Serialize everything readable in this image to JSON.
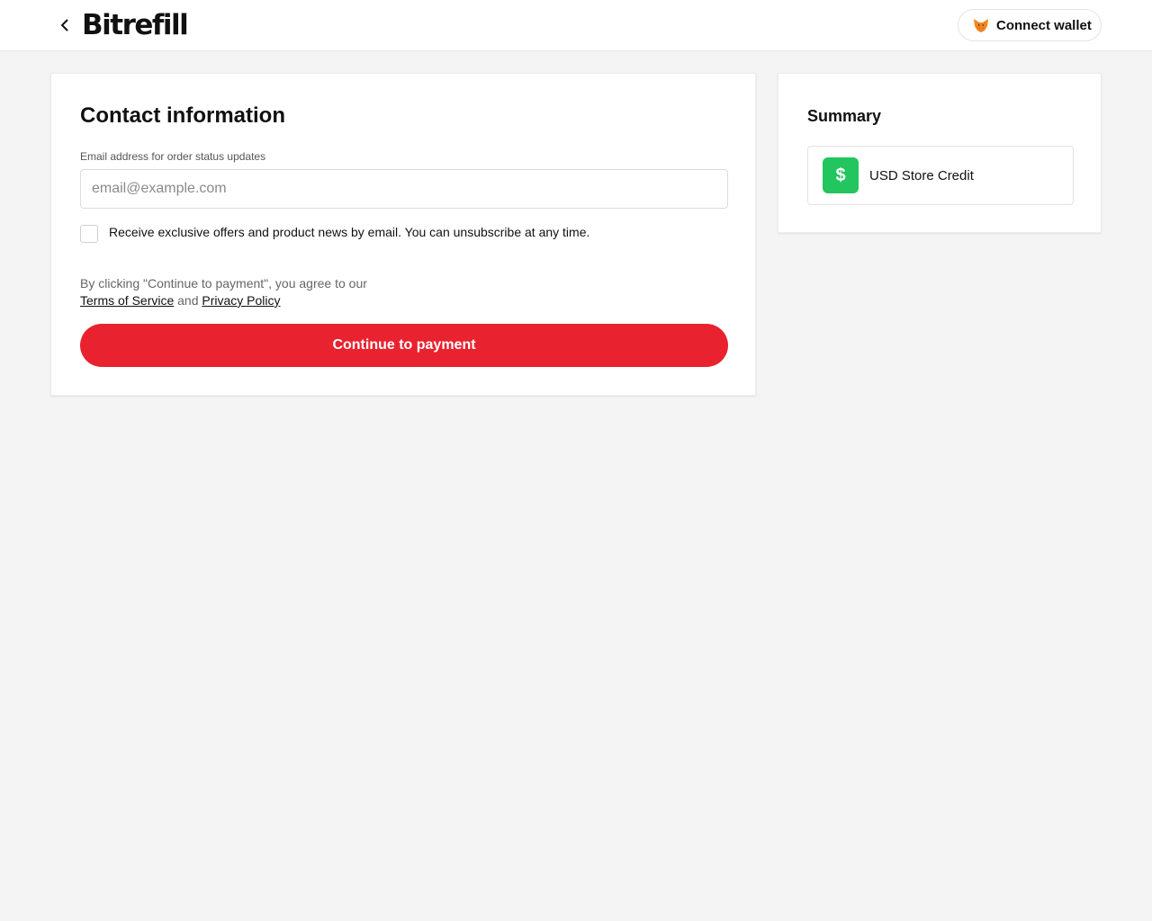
{
  "header": {
    "back_icon": "chevron-left-icon",
    "logo_text": "Bitrefill",
    "connect_wallet_label": "Connect wallet",
    "wallet_icon": "fox-icon"
  },
  "contact": {
    "title": "Contact information",
    "email_label": "Email address for order status updates",
    "email_placeholder": "email@example.com",
    "email_value": "",
    "offers_checked": false,
    "offers_label": "Receive exclusive offers and product news by email. You can unsubscribe at any time.",
    "agree_prefix": "By clicking \"Continue to payment\", you agree to our ",
    "terms_link": "Terms of Service",
    "agree_middle": " and ",
    "privacy_link": "Privacy Policy",
    "continue_label": "Continue to payment"
  },
  "summary": {
    "title": "Summary",
    "item_icon": "dollar-icon",
    "item_icon_glyph": "$",
    "item_label": "USD Store Credit"
  },
  "colors": {
    "accent": "#e8222f",
    "credit_icon_bg": "#22c55e",
    "page_bg": "#f4f4f4"
  }
}
